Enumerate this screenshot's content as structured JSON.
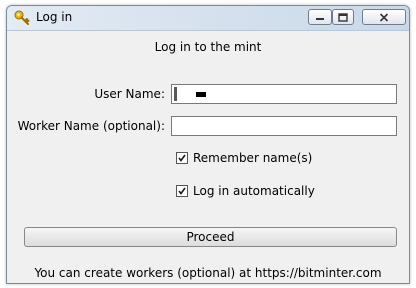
{
  "window": {
    "title": "Log in",
    "icon": "key-icon",
    "controls": [
      "minimize-icon",
      "maximize-icon",
      "close-icon"
    ]
  },
  "form": {
    "heading": "Log in to the mint",
    "user_name_label": "User Name:",
    "user_name_value": "",
    "worker_name_label": "Worker Name (optional):",
    "worker_name_value": "",
    "remember_label": "Remember name(s)",
    "remember_checked": true,
    "auto_login_label": "Log in automatically",
    "auto_login_checked": true,
    "proceed_label": "Proceed",
    "footer_text": "You can create workers (optional) at https://bitminter.com"
  }
}
